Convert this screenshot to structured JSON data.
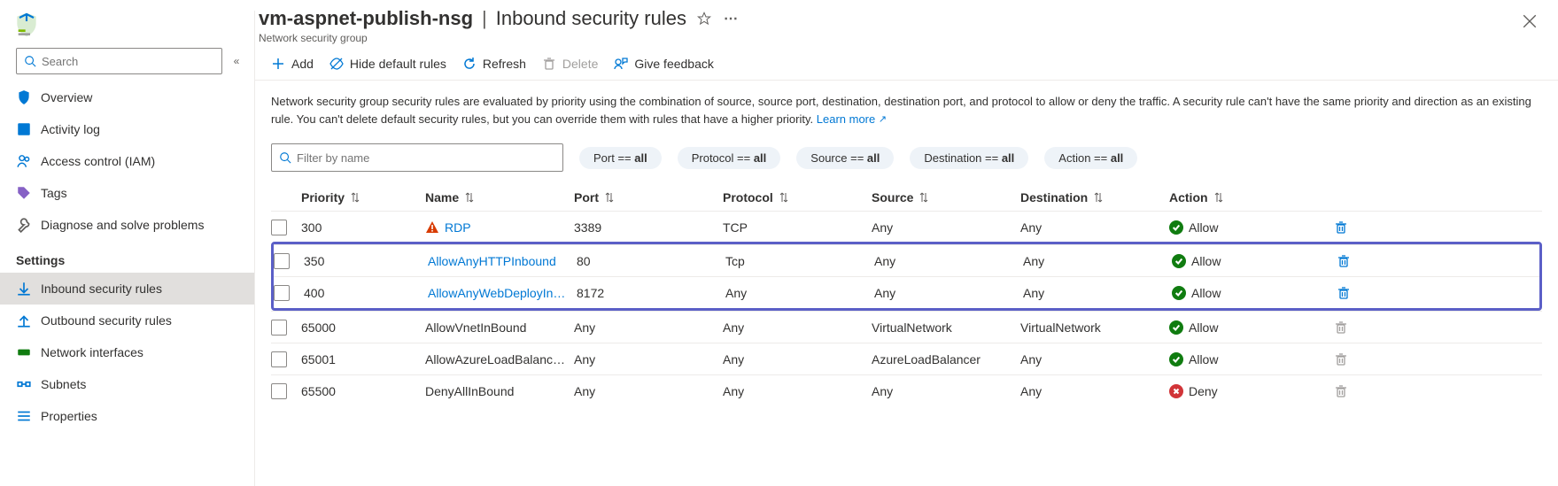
{
  "header": {
    "resource_name": "vm-aspnet-publish-nsg",
    "page_title": "Inbound security rules",
    "resource_type": "Network security group"
  },
  "sidebar": {
    "search_placeholder": "Search",
    "items_top": [
      {
        "label": "Overview",
        "icon": "shield"
      },
      {
        "label": "Activity log",
        "icon": "log"
      },
      {
        "label": "Access control (IAM)",
        "icon": "people"
      },
      {
        "label": "Tags",
        "icon": "tag"
      },
      {
        "label": "Diagnose and solve problems",
        "icon": "wrench"
      }
    ],
    "section_settings": "Settings",
    "items_settings": [
      {
        "label": "Inbound security rules",
        "icon": "arrow-in",
        "selected": true
      },
      {
        "label": "Outbound security rules",
        "icon": "arrow-out"
      },
      {
        "label": "Network interfaces",
        "icon": "nic"
      },
      {
        "label": "Subnets",
        "icon": "subnet"
      },
      {
        "label": "Properties",
        "icon": "properties"
      }
    ]
  },
  "toolbar": {
    "add": "Add",
    "hide_default": "Hide default rules",
    "refresh": "Refresh",
    "delete": "Delete",
    "feedback": "Give feedback"
  },
  "description": {
    "text": "Network security group security rules are evaluated by priority using the combination of source, source port, destination, destination port, and protocol to allow or deny the traffic. A security rule can't have the same priority and direction as an existing rule. You can't delete default security rules, but you can override them with rules that have a higher priority.",
    "learn_more": "Learn more"
  },
  "filter": {
    "placeholder": "Filter by name",
    "pills": [
      {
        "label": "Port == ",
        "value": "all"
      },
      {
        "label": "Protocol == ",
        "value": "all"
      },
      {
        "label": "Source == ",
        "value": "all"
      },
      {
        "label": "Destination == ",
        "value": "all"
      },
      {
        "label": "Action == ",
        "value": "all"
      }
    ]
  },
  "columns": [
    "Priority",
    "Name",
    "Port",
    "Protocol",
    "Source",
    "Destination",
    "Action"
  ],
  "rules": [
    {
      "priority": "300",
      "name": "RDP",
      "port": "3389",
      "protocol": "TCP",
      "source": "Any",
      "destination": "Any",
      "action": "Allow",
      "link": true,
      "warn": true,
      "highlight": false,
      "deletable": true
    },
    {
      "priority": "350",
      "name": "AllowAnyHTTPInbound",
      "port": "80",
      "protocol": "Tcp",
      "source": "Any",
      "destination": "Any",
      "action": "Allow",
      "link": true,
      "highlight": true,
      "deletable": true
    },
    {
      "priority": "400",
      "name": "AllowAnyWebDeployIn…",
      "port": "8172",
      "protocol": "Any",
      "source": "Any",
      "destination": "Any",
      "action": "Allow",
      "link": true,
      "highlight": true,
      "deletable": true
    },
    {
      "priority": "65000",
      "name": "AllowVnetInBound",
      "port": "Any",
      "protocol": "Any",
      "source": "VirtualNetwork",
      "destination": "VirtualNetwork",
      "action": "Allow",
      "link": false,
      "highlight": false,
      "deletable": false
    },
    {
      "priority": "65001",
      "name": "AllowAzureLoadBalanc…",
      "port": "Any",
      "protocol": "Any",
      "source": "AzureLoadBalancer",
      "destination": "Any",
      "action": "Allow",
      "link": false,
      "highlight": false,
      "deletable": false
    },
    {
      "priority": "65500",
      "name": "DenyAllInBound",
      "port": "Any",
      "protocol": "Any",
      "source": "Any",
      "destination": "Any",
      "action": "Deny",
      "link": false,
      "highlight": false,
      "deletable": false
    }
  ]
}
